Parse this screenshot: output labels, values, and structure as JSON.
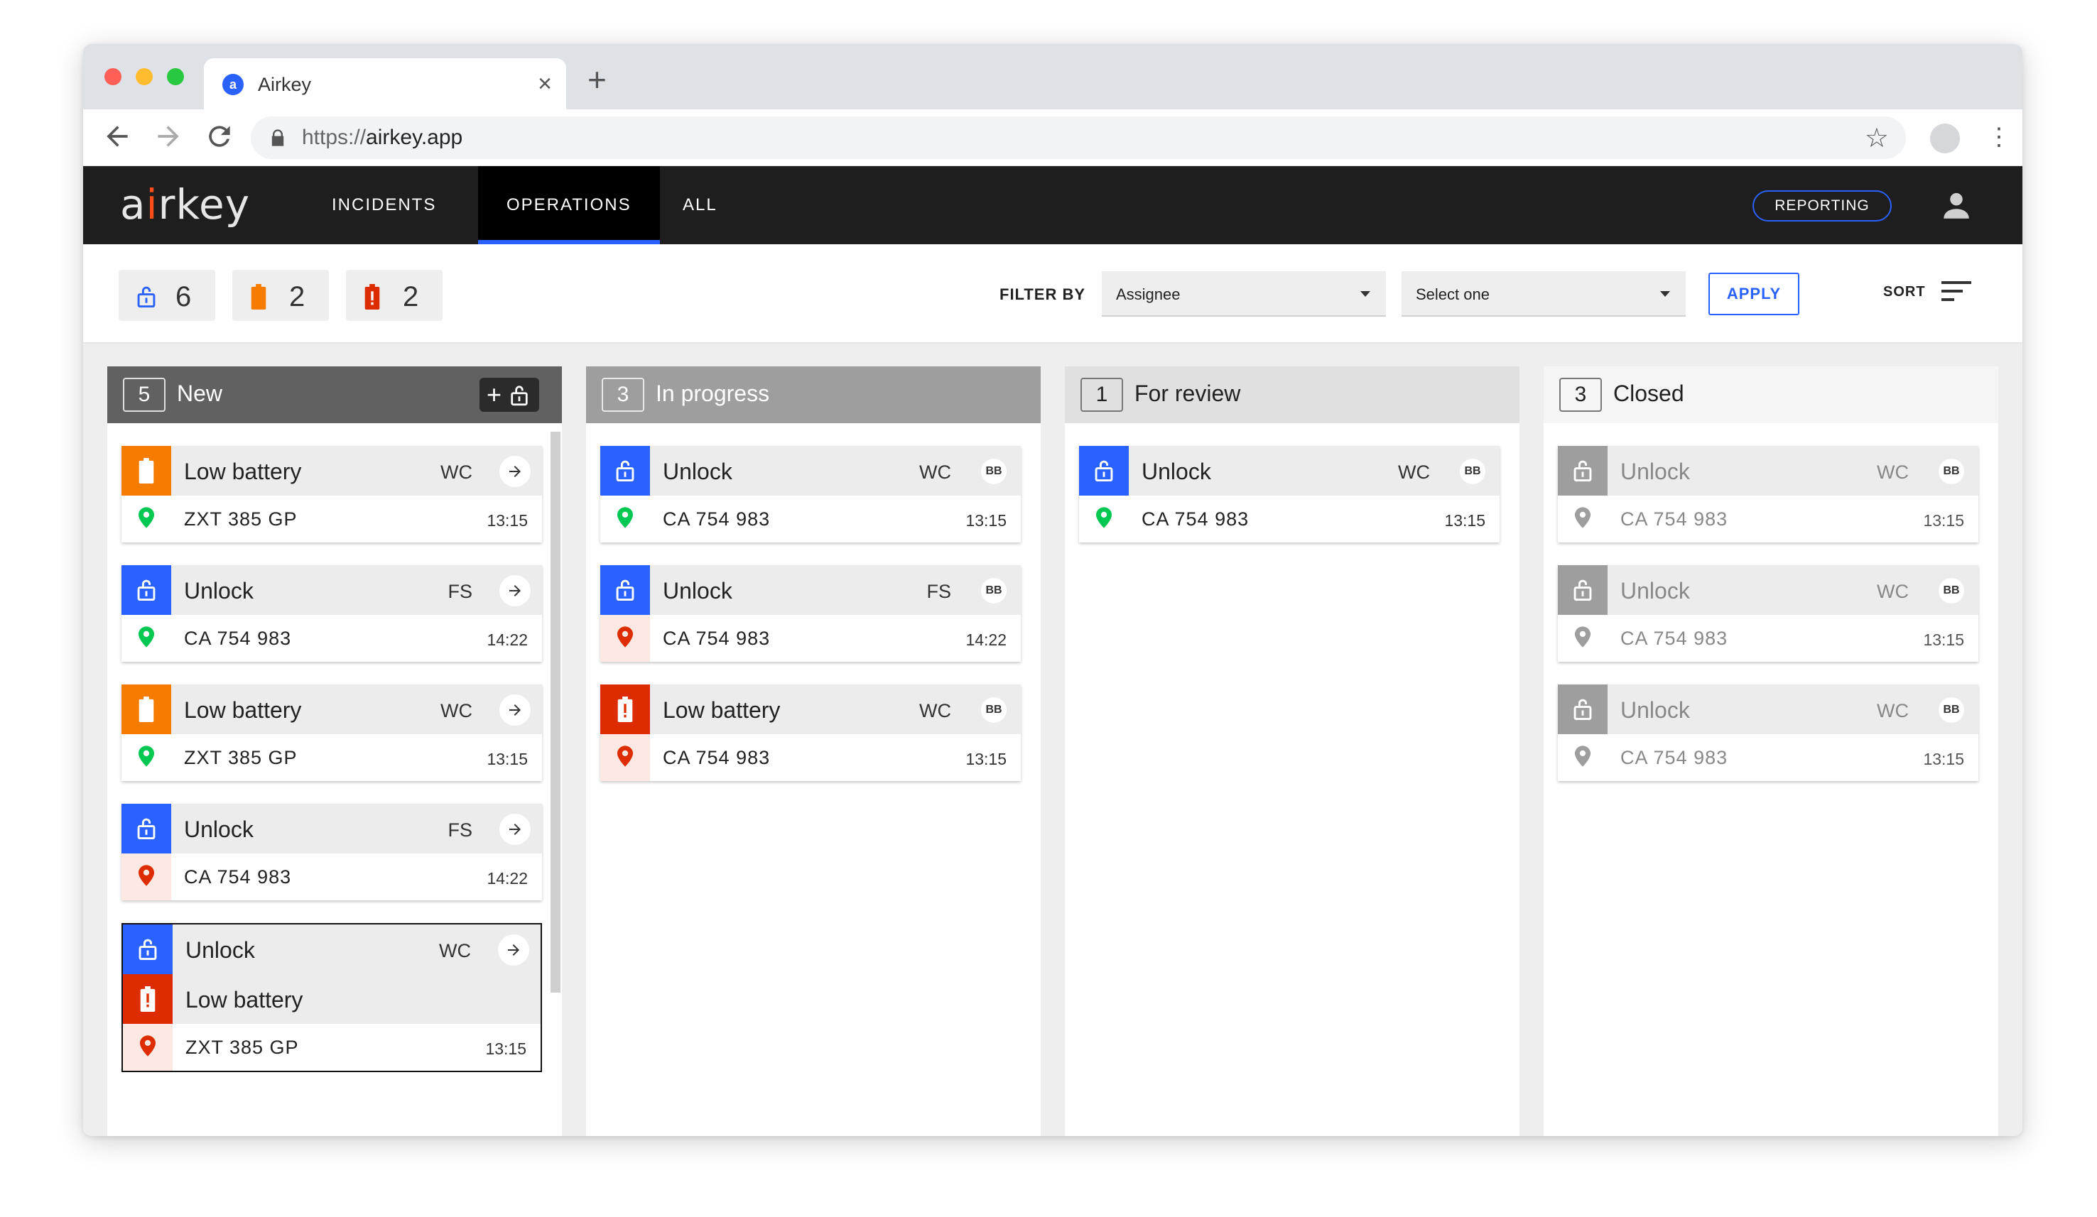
{
  "browser": {
    "tab_title": "Airkey",
    "tab_favicon_letter": "a",
    "url_scheme": "https://",
    "url_host": "airkey.app"
  },
  "header": {
    "logo_pre": "a",
    "logo_dot": "i",
    "logo_post": "rkey",
    "nav": [
      "INCIDENTS",
      "OPERATIONS",
      "ALL"
    ],
    "active_nav": "OPERATIONS",
    "reporting_label": "REPORTING"
  },
  "toolbar": {
    "stats": [
      {
        "kind": "unlock",
        "count": "6"
      },
      {
        "kind": "low-battery",
        "count": "2"
      },
      {
        "kind": "critical-battery",
        "count": "2"
      }
    ],
    "filter_label": "FILTER BY",
    "filter_assignee": "Assignee",
    "filter_second": "Select one",
    "apply_label": "APPLY",
    "sort_label": "SORT"
  },
  "colors": {
    "blue": "#2962ff",
    "orange": "#f57c00",
    "red": "#dd2c00",
    "green": "#00c853",
    "grey": "#9e9e9e"
  },
  "columns": [
    {
      "count": "5",
      "title": "New",
      "cards": [
        {
          "type": "Low battery",
          "initials": "WC",
          "plate": "ZXT 385 GP",
          "time": "13:15"
        },
        {
          "type": "Unlock",
          "initials": "FS",
          "plate": "CA 754 983",
          "time": "14:22"
        },
        {
          "type": "Low battery",
          "initials": "WC",
          "plate": "ZXT 385 GP",
          "time": "13:15"
        },
        {
          "type": "Unlock",
          "initials": "FS",
          "plate": "CA 754 983",
          "time": "14:22"
        },
        {
          "type": "Unlock",
          "initials": "WC",
          "second_type": "Low battery",
          "plate": "ZXT 385 GP",
          "time": "13:15"
        }
      ]
    },
    {
      "count": "3",
      "title": "In progress",
      "cards": [
        {
          "type": "Unlock",
          "initials": "WC",
          "assignee": "BB",
          "plate": "CA 754 983",
          "time": "13:15"
        },
        {
          "type": "Unlock",
          "initials": "FS",
          "assignee": "BB",
          "plate": "CA 754 983",
          "time": "14:22"
        },
        {
          "type": "Low battery",
          "initials": "WC",
          "assignee": "BB",
          "plate": "CA 754 983",
          "time": "13:15"
        }
      ]
    },
    {
      "count": "1",
      "title": "For review",
      "cards": [
        {
          "type": "Unlock",
          "initials": "WC",
          "assignee": "BB",
          "plate": "CA 754 983",
          "time": "13:15"
        }
      ]
    },
    {
      "count": "3",
      "title": "Closed",
      "cards": [
        {
          "type": "Unlock",
          "initials": "WC",
          "assignee": "BB",
          "plate": "CA 754 983",
          "time": "13:15"
        },
        {
          "type": "Unlock",
          "initials": "WC",
          "assignee": "BB",
          "plate": "CA 754 983",
          "time": "13:15"
        },
        {
          "type": "Unlock",
          "initials": "WC",
          "assignee": "BB",
          "plate": "CA 754 983",
          "time": "13:15"
        }
      ]
    }
  ]
}
